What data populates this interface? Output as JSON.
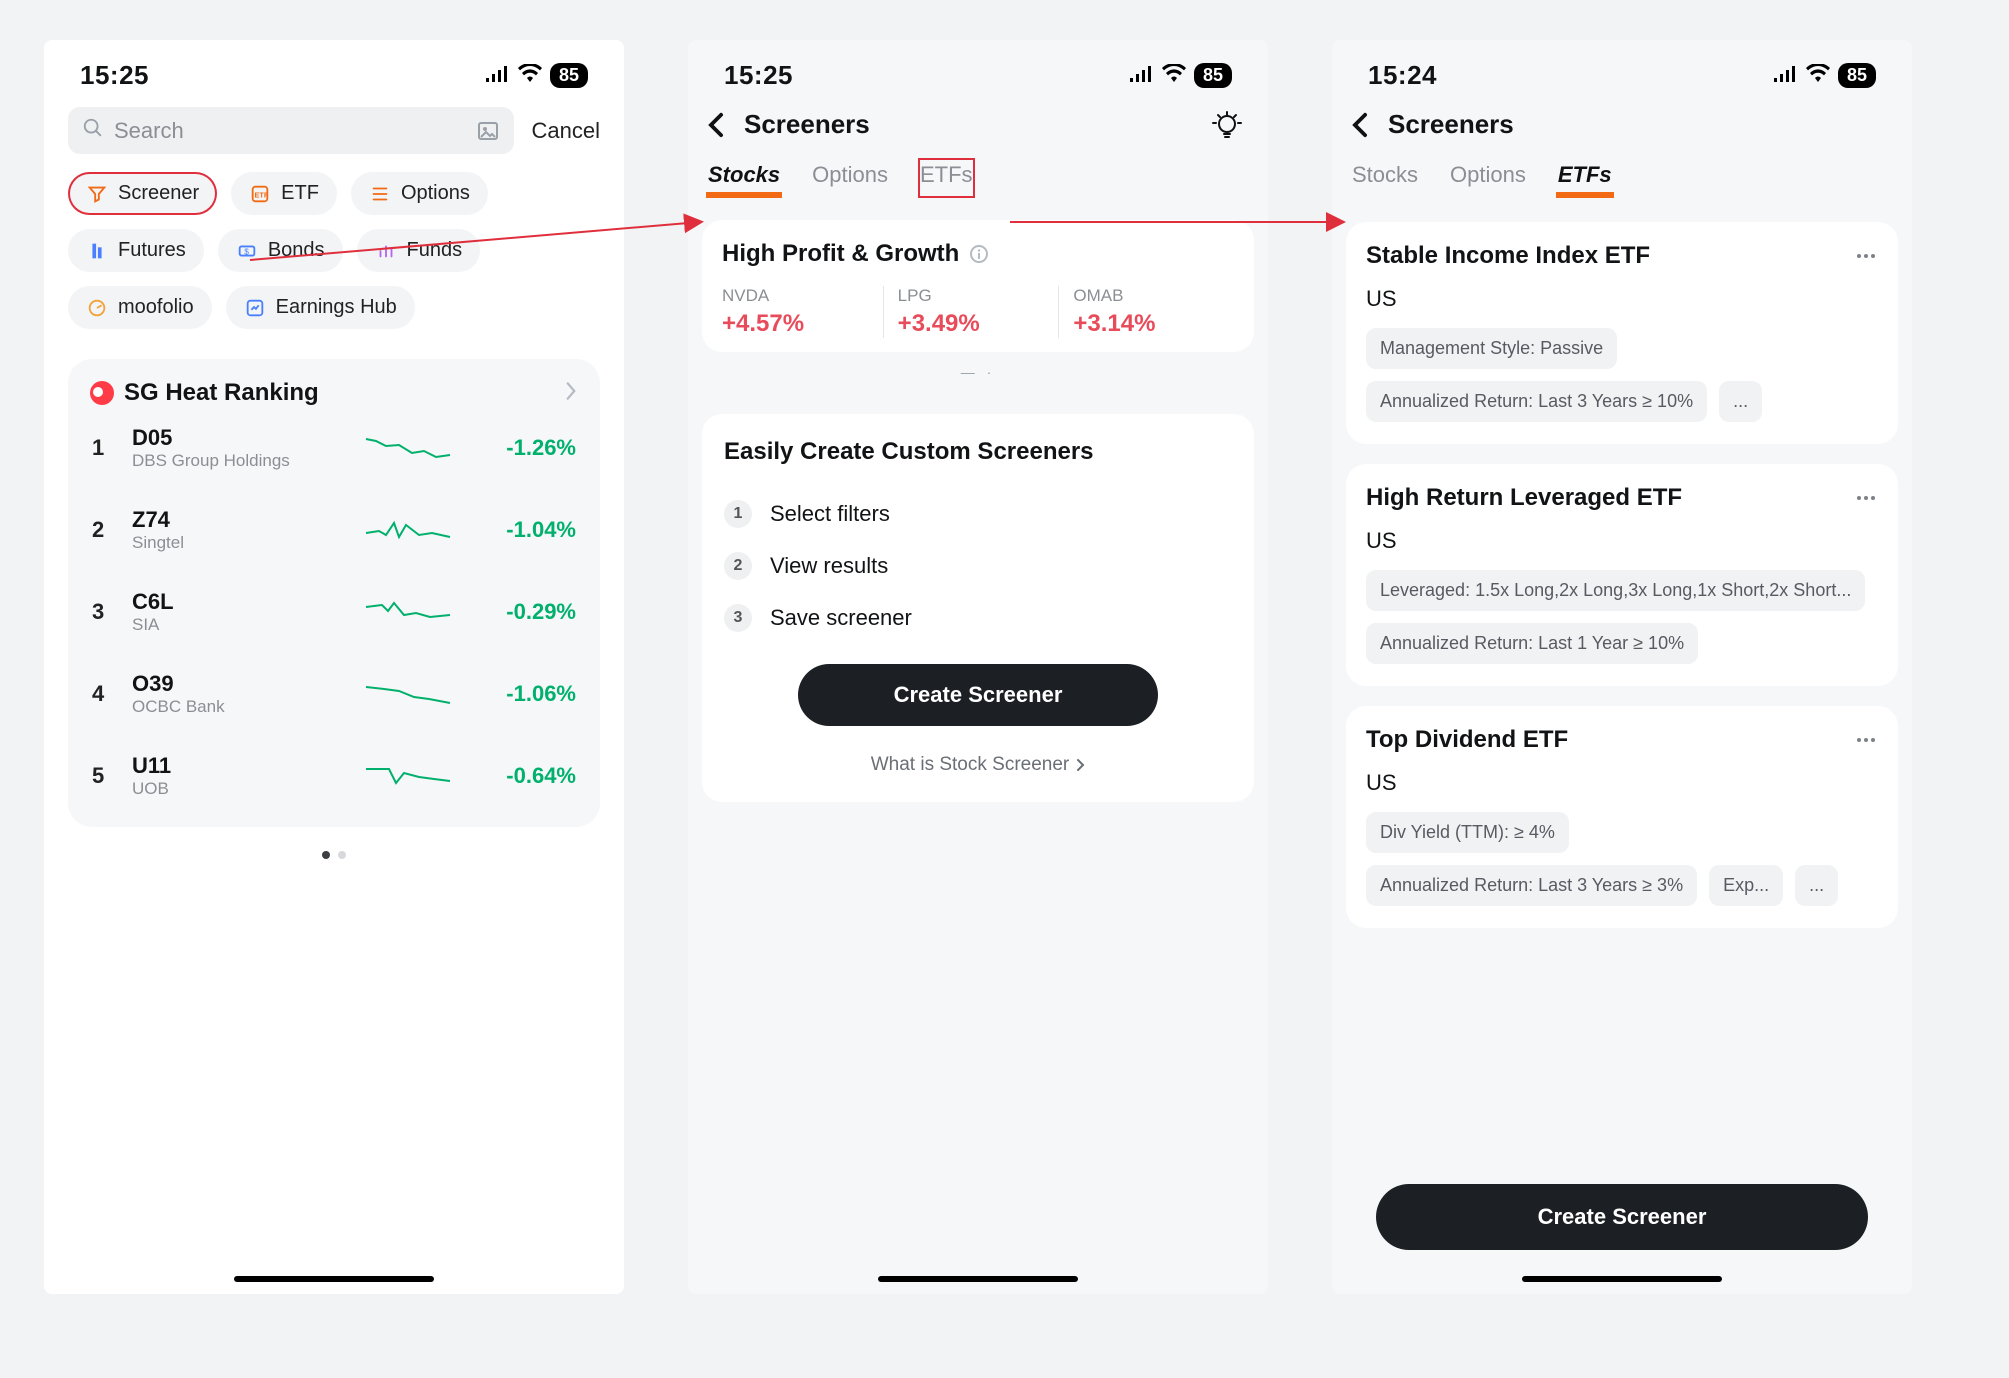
{
  "status": {
    "battery": "85"
  },
  "screen1": {
    "clock": "15:25",
    "search_placeholder": "Search",
    "cancel": "Cancel",
    "chips": {
      "screener": "Screener",
      "etf": "ETF",
      "options": "Options",
      "futures": "Futures",
      "bonds": "Bonds",
      "funds": "Funds",
      "moofolio": "moofolio",
      "earnings_hub": "Earnings Hub"
    },
    "heat_title": "SG Heat Ranking",
    "rows": [
      {
        "n": "1",
        "sym": "D05",
        "name": "DBS Group Holdings",
        "chg": "-1.26%"
      },
      {
        "n": "2",
        "sym": "Z74",
        "name": "Singtel",
        "chg": "-1.04%"
      },
      {
        "n": "3",
        "sym": "C6L",
        "name": "SIA",
        "chg": "-0.29%"
      },
      {
        "n": "4",
        "sym": "O39",
        "name": "OCBC Bank",
        "chg": "-1.06%"
      },
      {
        "n": "5",
        "sym": "U11",
        "name": "UOB",
        "chg": "-0.64%"
      }
    ]
  },
  "screen2": {
    "clock": "15:25",
    "title": "Screeners",
    "tabs": {
      "stocks": "Stocks",
      "options": "Options",
      "etfs": "ETFs"
    },
    "profit": {
      "title": "High Profit & Growth",
      "tickers": [
        {
          "sym": "NVDA",
          "chg": "+4.57%"
        },
        {
          "sym": "LPG",
          "chg": "+3.49%"
        },
        {
          "sym": "OMAB",
          "chg": "+3.14%"
        }
      ]
    },
    "steps_title": "Easily Create Custom Screeners",
    "steps": [
      {
        "n": "1",
        "t": "Select filters"
      },
      {
        "n": "2",
        "t": "View results"
      },
      {
        "n": "3",
        "t": "Save screener"
      }
    ],
    "create_label": "Create Screener",
    "what_is": "What is Stock Screener"
  },
  "screen3": {
    "clock": "15:24",
    "title": "Screeners",
    "tabs": {
      "stocks": "Stocks",
      "options": "Options",
      "etfs": "ETFs"
    },
    "cards": [
      {
        "title": "Stable Income Index ETF",
        "region": "US",
        "tags": [
          "Management Style: Passive",
          "Annualized Return: Last 3 Years ≥ 10%",
          "..."
        ]
      },
      {
        "title": "High Return Leveraged ETF",
        "region": "US",
        "tags": [
          "Leveraged: 1.5x Long,2x Long,3x Long,1x Short,2x Short...",
          "Annualized Return: Last 1 Year ≥ 10%"
        ]
      },
      {
        "title": "Top Dividend ETF",
        "region": "US",
        "tags": [
          "Div Yield (TTM): ≥ 4%",
          "Annualized Return: Last 3 Years ≥ 3%",
          "Exp...",
          "..."
        ]
      }
    ],
    "create_label": "Create Screener"
  }
}
